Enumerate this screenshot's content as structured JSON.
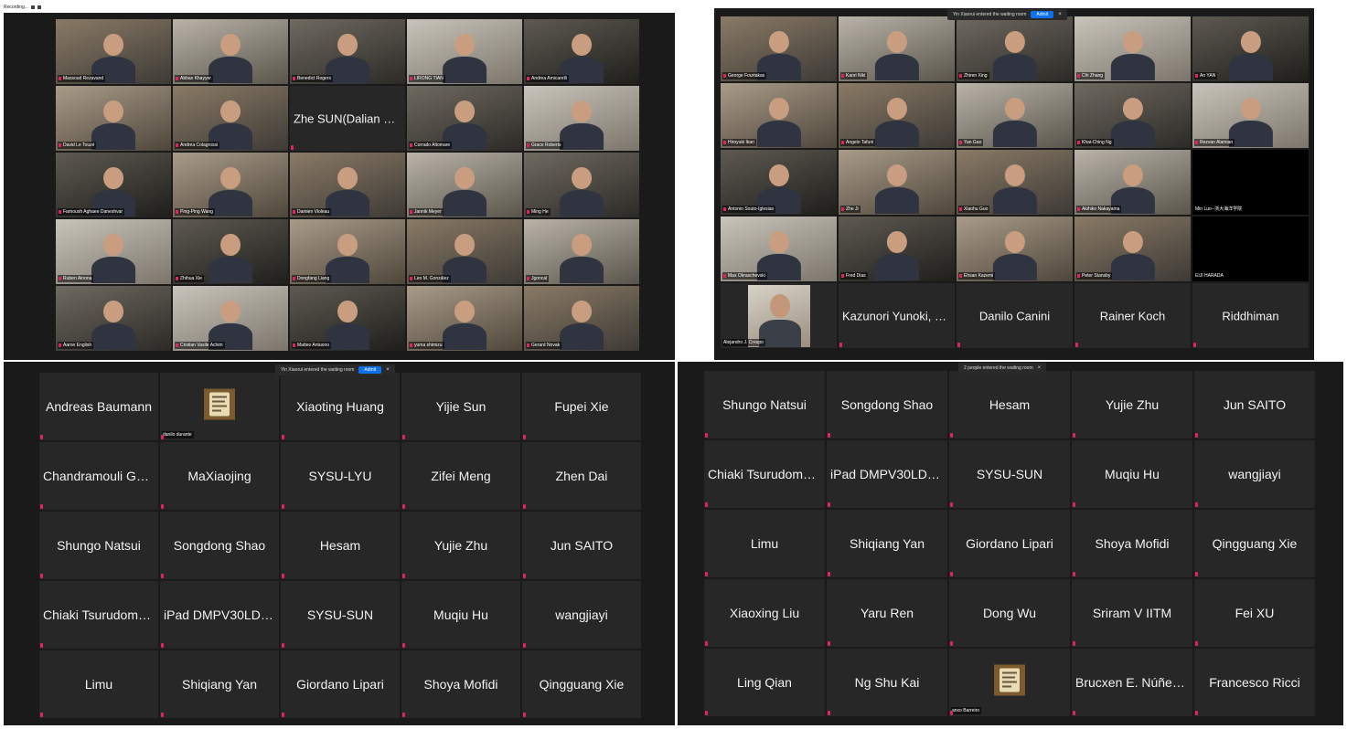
{
  "recording": {
    "label": "Recording..."
  },
  "panels": {
    "top_left": {
      "tiles": [
        {
          "name": "Massoud Rezavand",
          "kind": "video"
        },
        {
          "name": "Abbas Khayyer",
          "kind": "video"
        },
        {
          "name": "Benedict Rogers",
          "kind": "video"
        },
        {
          "name": "LIRONG TIAN",
          "kind": "video"
        },
        {
          "name": "Andrea Amicarelli",
          "kind": "video"
        },
        {
          "name": "David Le Touzé",
          "kind": "video"
        },
        {
          "name": "Andrea Colagrossi",
          "kind": "video"
        },
        {
          "name": "Zhe SUN(Dalian Un...",
          "kind": "text"
        },
        {
          "name": "Corrado Altomare",
          "kind": "video"
        },
        {
          "name": "Grace Roberts",
          "kind": "video"
        },
        {
          "name": "Farnoush Aghaee Daneshvar",
          "kind": "video"
        },
        {
          "name": "Ping-Ping Wang",
          "kind": "video"
        },
        {
          "name": "Damien Violeau",
          "kind": "video"
        },
        {
          "name": "Jannik Meyer",
          "kind": "video"
        },
        {
          "name": "Ming He",
          "kind": "video"
        },
        {
          "name": "Ruben Ainona",
          "kind": "video"
        },
        {
          "name": "Zhihua Xie",
          "kind": "video"
        },
        {
          "name": "Dongfang Liang",
          "kind": "video"
        },
        {
          "name": "Leo M. González",
          "kind": "video"
        },
        {
          "name": "Jgoncal",
          "kind": "video"
        },
        {
          "name": "Aaron English",
          "kind": "video"
        },
        {
          "name": "Cristian Vasile Achim",
          "kind": "video"
        },
        {
          "name": "Matteo Antuono",
          "kind": "video"
        },
        {
          "name": "yuma shimizu",
          "kind": "video"
        },
        {
          "name": "Gerard Novak",
          "kind": "video"
        }
      ]
    },
    "top_right": {
      "banner": {
        "text": "Yin Xiaorui entered the waiting room",
        "admit": "Admit",
        "close": "×"
      },
      "tiles": [
        {
          "name": "George Fourtakas",
          "kind": "video"
        },
        {
          "name": "Kaori Niki",
          "kind": "video"
        },
        {
          "name": "Zhiren Xing",
          "kind": "video"
        },
        {
          "name": "Chi Zhang",
          "kind": "video"
        },
        {
          "name": "An YAN",
          "kind": "video"
        },
        {
          "name": "Hiroyuki Ikari",
          "kind": "video"
        },
        {
          "name": "Angelo Tafuni",
          "kind": "video"
        },
        {
          "name": "Yan Gao",
          "kind": "video"
        },
        {
          "name": "Khai-Ching Ng",
          "kind": "video"
        },
        {
          "name": "Rezvan Alamian",
          "kind": "video"
        },
        {
          "name": "Antonio Souto-Iglesias",
          "kind": "video"
        },
        {
          "name": "Zhe Ji",
          "kind": "video"
        },
        {
          "name": "Xiaohu Guo",
          "kind": "video"
        },
        {
          "name": "Akihiko Nakayama",
          "kind": "video"
        },
        {
          "name": "Min Luo--浙大海洋学院",
          "kind": "blank"
        },
        {
          "name": "Max Okraschevski",
          "kind": "video"
        },
        {
          "name": "Fred Dias",
          "kind": "video"
        },
        {
          "name": "Ehsan Kazemi",
          "kind": "video"
        },
        {
          "name": "Peter Stansby",
          "kind": "video"
        },
        {
          "name": "EIJI HARADA",
          "kind": "blank"
        },
        {
          "name": "Alejandro J. Crespo",
          "kind": "self"
        },
        {
          "name": "Kazunori Yunoki, Ky...",
          "kind": "text"
        },
        {
          "name": "Danilo Canini",
          "kind": "text"
        },
        {
          "name": "Rainer Koch",
          "kind": "text"
        },
        {
          "name": "Riddhiman",
          "kind": "text"
        }
      ]
    },
    "bottom_left": {
      "banner": {
        "text": "Yin Xiaorui entered the waiting room",
        "admit": "Admit",
        "close": "×"
      },
      "tiles": [
        {
          "name": "Andreas Baumann",
          "kind": "text"
        },
        {
          "name": "danilo durante",
          "kind": "avatar"
        },
        {
          "name": "Xiaoting Huang",
          "kind": "text"
        },
        {
          "name": "Yijie Sun",
          "kind": "text"
        },
        {
          "name": "Fupei Xie",
          "kind": "text"
        },
        {
          "name": "Chandramouli Gna...",
          "kind": "text"
        },
        {
          "name": "MaXiaojing",
          "kind": "text"
        },
        {
          "name": "SYSU-LYU",
          "kind": "text"
        },
        {
          "name": "Zifei Meng",
          "kind": "text"
        },
        {
          "name": "Zhen Dai",
          "kind": "text"
        },
        {
          "name": "Shungo Natsui",
          "kind": "text"
        },
        {
          "name": "Songdong Shao",
          "kind": "text"
        },
        {
          "name": "Hesam",
          "kind": "text"
        },
        {
          "name": "Yujie Zhu",
          "kind": "text"
        },
        {
          "name": "Jun SAITO",
          "kind": "text"
        },
        {
          "name": "Chiaki Tsurudome (...",
          "kind": "text"
        },
        {
          "name": "iPad DMPV30LDH...",
          "kind": "text"
        },
        {
          "name": "SYSU-SUN",
          "kind": "text"
        },
        {
          "name": "Muqiu Hu",
          "kind": "text"
        },
        {
          "name": "wangjiayi",
          "kind": "text"
        },
        {
          "name": "Limu",
          "kind": "text"
        },
        {
          "name": "Shiqiang Yan",
          "kind": "text"
        },
        {
          "name": "Giordano Lipari",
          "kind": "text"
        },
        {
          "name": "Shoya Mofidi",
          "kind": "text"
        },
        {
          "name": "Qingguang Xie",
          "kind": "text"
        }
      ]
    },
    "bottom_right": {
      "banner": {
        "text": "2 people entered the waiting room",
        "close": "×"
      },
      "tiles": [
        {
          "name": "Shungo Natsui",
          "kind": "text"
        },
        {
          "name": "Songdong Shao",
          "kind": "text"
        },
        {
          "name": "Hesam",
          "kind": "text"
        },
        {
          "name": "Yujie Zhu",
          "kind": "text"
        },
        {
          "name": "Jun SAITO",
          "kind": "text"
        },
        {
          "name": "Chiaki Tsurudome (...",
          "kind": "text"
        },
        {
          "name": "iPad DMPV30LDH...",
          "kind": "text"
        },
        {
          "name": "SYSU-SUN",
          "kind": "text"
        },
        {
          "name": "Muqiu Hu",
          "kind": "text"
        },
        {
          "name": "wangjiayi",
          "kind": "text"
        },
        {
          "name": "Limu",
          "kind": "text"
        },
        {
          "name": "Shiqiang Yan",
          "kind": "text"
        },
        {
          "name": "Giordano Lipari",
          "kind": "text"
        },
        {
          "name": "Shoya Mofidi",
          "kind": "text"
        },
        {
          "name": "Qingguang Xie",
          "kind": "text"
        },
        {
          "name": "Xiaoxing Liu",
          "kind": "text"
        },
        {
          "name": "Yaru Ren",
          "kind": "text"
        },
        {
          "name": "Dong Wu",
          "kind": "text"
        },
        {
          "name": "Sriram V IITM",
          "kind": "text"
        },
        {
          "name": "Fei XU",
          "kind": "text"
        },
        {
          "name": "Ling Qian",
          "kind": "text"
        },
        {
          "name": "Ng Shu Kai",
          "kind": "text"
        },
        {
          "name": "anxo Barreiro",
          "kind": "avatar"
        },
        {
          "name": "Brucxen E. Núñez R...",
          "kind": "text"
        },
        {
          "name": "Francesco Ricci",
          "kind": "text"
        }
      ]
    }
  }
}
